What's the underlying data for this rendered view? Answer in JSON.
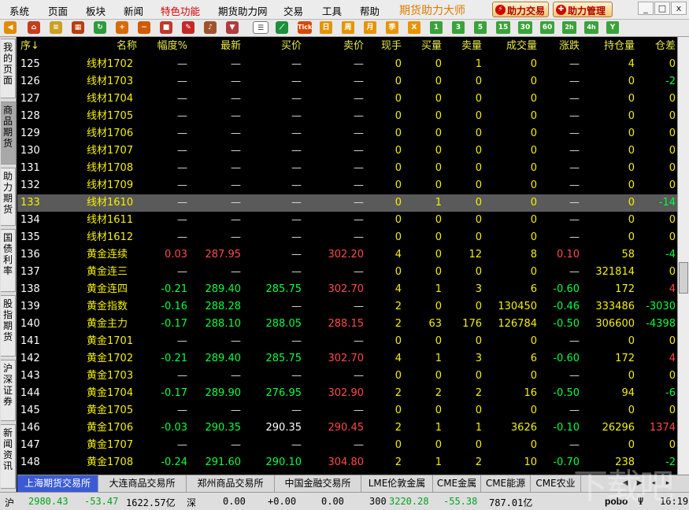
{
  "menu": {
    "items": [
      "系统",
      "页面",
      "板块",
      "新闻",
      "特色功能",
      "期货助力网",
      "交易",
      "工具",
      "帮助"
    ],
    "brand": "期货助力大师",
    "trade_button": "助力交易",
    "manage_button": "助力管理",
    "window_buttons": [
      "_",
      "□",
      "x"
    ]
  },
  "toolbar": {
    "period_buttons": [
      "日",
      "周",
      "月",
      "季",
      "X",
      "1",
      "3",
      "5",
      "15",
      "30",
      "60",
      "2h",
      "4h",
      "Y"
    ],
    "tick_label": "Tick"
  },
  "side_tabs": [
    {
      "label": "我的页面",
      "active": false
    },
    {
      "label": "商品期货",
      "active": true
    },
    {
      "label": "助力期货",
      "active": false
    },
    {
      "label": "国债利率",
      "active": false
    },
    {
      "label": "股指期货",
      "active": false
    },
    {
      "label": "沪深证券",
      "active": false
    },
    {
      "label": "新闻资讯",
      "active": false
    }
  ],
  "table": {
    "headers": [
      "序↓",
      "名称",
      "幅度%",
      "最新",
      "买价",
      "卖价",
      "现手",
      "买量",
      "卖量",
      "成交量",
      "涨跌",
      "持仓量",
      "仓差"
    ],
    "rows": [
      [
        "125",
        "线材1702",
        "—",
        "—",
        "—",
        "—",
        "0",
        "0",
        "1",
        "0",
        "—",
        "4",
        "0"
      ],
      [
        "126",
        "线材1703",
        "—",
        "—",
        "—",
        "—",
        "0",
        "0",
        "0",
        "0",
        "—",
        "0",
        "-2"
      ],
      [
        "127",
        "线材1704",
        "—",
        "—",
        "—",
        "—",
        "0",
        "0",
        "0",
        "0",
        "—",
        "0",
        "0"
      ],
      [
        "128",
        "线材1705",
        "—",
        "—",
        "—",
        "—",
        "0",
        "0",
        "0",
        "0",
        "—",
        "0",
        "0"
      ],
      [
        "129",
        "线材1706",
        "—",
        "—",
        "—",
        "—",
        "0",
        "0",
        "0",
        "0",
        "—",
        "0",
        "0"
      ],
      [
        "130",
        "线材1707",
        "—",
        "—",
        "—",
        "—",
        "0",
        "0",
        "0",
        "0",
        "—",
        "0",
        "0"
      ],
      [
        "131",
        "线材1708",
        "—",
        "—",
        "—",
        "—",
        "0",
        "0",
        "0",
        "0",
        "—",
        "0",
        "0"
      ],
      [
        "132",
        "线材1709",
        "—",
        "—",
        "—",
        "—",
        "0",
        "0",
        "0",
        "0",
        "—",
        "0",
        "0"
      ],
      [
        "133",
        "线材1610",
        "—",
        "—",
        "—",
        "—",
        "0",
        "1",
        "0",
        "0",
        "—",
        "0",
        "-14"
      ],
      [
        "134",
        "线材1611",
        "—",
        "—",
        "—",
        "—",
        "0",
        "0",
        "0",
        "0",
        "—",
        "0",
        "0"
      ],
      [
        "135",
        "线材1612",
        "—",
        "—",
        "—",
        "—",
        "0",
        "0",
        "0",
        "0",
        "—",
        "0",
        "0"
      ],
      [
        "136",
        "黄金连续",
        "0.03",
        "287.95",
        "—",
        "302.20",
        "4",
        "0",
        "12",
        "8",
        "0.10",
        "58",
        "-4"
      ],
      [
        "137",
        "黄金连三",
        "—",
        "—",
        "—",
        "—",
        "0",
        "0",
        "0",
        "0",
        "—",
        "321814",
        "0"
      ],
      [
        "138",
        "黄金连四",
        "-0.21",
        "289.40",
        "285.75",
        "302.70",
        "4",
        "1",
        "3",
        "6",
        "-0.60",
        "172",
        "4"
      ],
      [
        "139",
        "黄金指数",
        "-0.16",
        "288.28",
        "—",
        "—",
        "2",
        "0",
        "0",
        "130450",
        "-0.46",
        "333486",
        "-3030"
      ],
      [
        "140",
        "黄金主力",
        "-0.17",
        "288.10",
        "288.05",
        "288.15",
        "2",
        "63",
        "176",
        "126784",
        "-0.50",
        "306600",
        "-4398"
      ],
      [
        "141",
        "黄金1701",
        "—",
        "—",
        "—",
        "—",
        "0",
        "0",
        "0",
        "0",
        "—",
        "0",
        "0"
      ],
      [
        "142",
        "黄金1702",
        "-0.21",
        "289.40",
        "285.75",
        "302.70",
        "4",
        "1",
        "3",
        "6",
        "-0.60",
        "172",
        "4"
      ],
      [
        "143",
        "黄金1703",
        "—",
        "—",
        "—",
        "—",
        "0",
        "0",
        "0",
        "0",
        "—",
        "0",
        "0"
      ],
      [
        "144",
        "黄金1704",
        "-0.17",
        "289.90",
        "276.95",
        "302.90",
        "2",
        "2",
        "2",
        "16",
        "-0.50",
        "94",
        "-6"
      ],
      [
        "145",
        "黄金1705",
        "—",
        "—",
        "—",
        "—",
        "0",
        "0",
        "0",
        "0",
        "—",
        "0",
        "0"
      ],
      [
        "146",
        "黄金1706",
        "-0.03",
        "290.35",
        "290.35",
        "290.45",
        "2",
        "1",
        "1",
        "3626",
        "-0.10",
        "26296",
        "1374"
      ],
      [
        "147",
        "黄金1707",
        "—",
        "—",
        "—",
        "—",
        "0",
        "0",
        "0",
        "0",
        "—",
        "0",
        "0"
      ],
      [
        "148",
        "黄金1708",
        "-0.24",
        "291.60",
        "290.10",
        "304.80",
        "2",
        "1",
        "2",
        "10",
        "-0.70",
        "238",
        "-2"
      ]
    ],
    "selected_row_index": 8
  },
  "exchange_tabs": [
    "上海期货交易所",
    "大连商品交易所",
    "郑州商品交易所",
    "中国金融交易所",
    "LME伦敦金属",
    "CME金属",
    "CME能源",
    "CME农业"
  ],
  "active_exchange": 0,
  "status": {
    "sh_label": "沪",
    "sh_index": "2980.43",
    "sh_change": "-53.47",
    "sh_amount": "1622.57亿",
    "sz_label": "深",
    "sz_index": "0.00",
    "sz_change": "+0.00",
    "sz_amount": "0.00",
    "sz_index2": "300",
    "sz_value2": "3220.28",
    "sz_change2": "-55.38",
    "sz_amount2": "787.01亿",
    "brand": "pobo",
    "time": "16:19"
  },
  "watermark_text": "下载吧"
}
